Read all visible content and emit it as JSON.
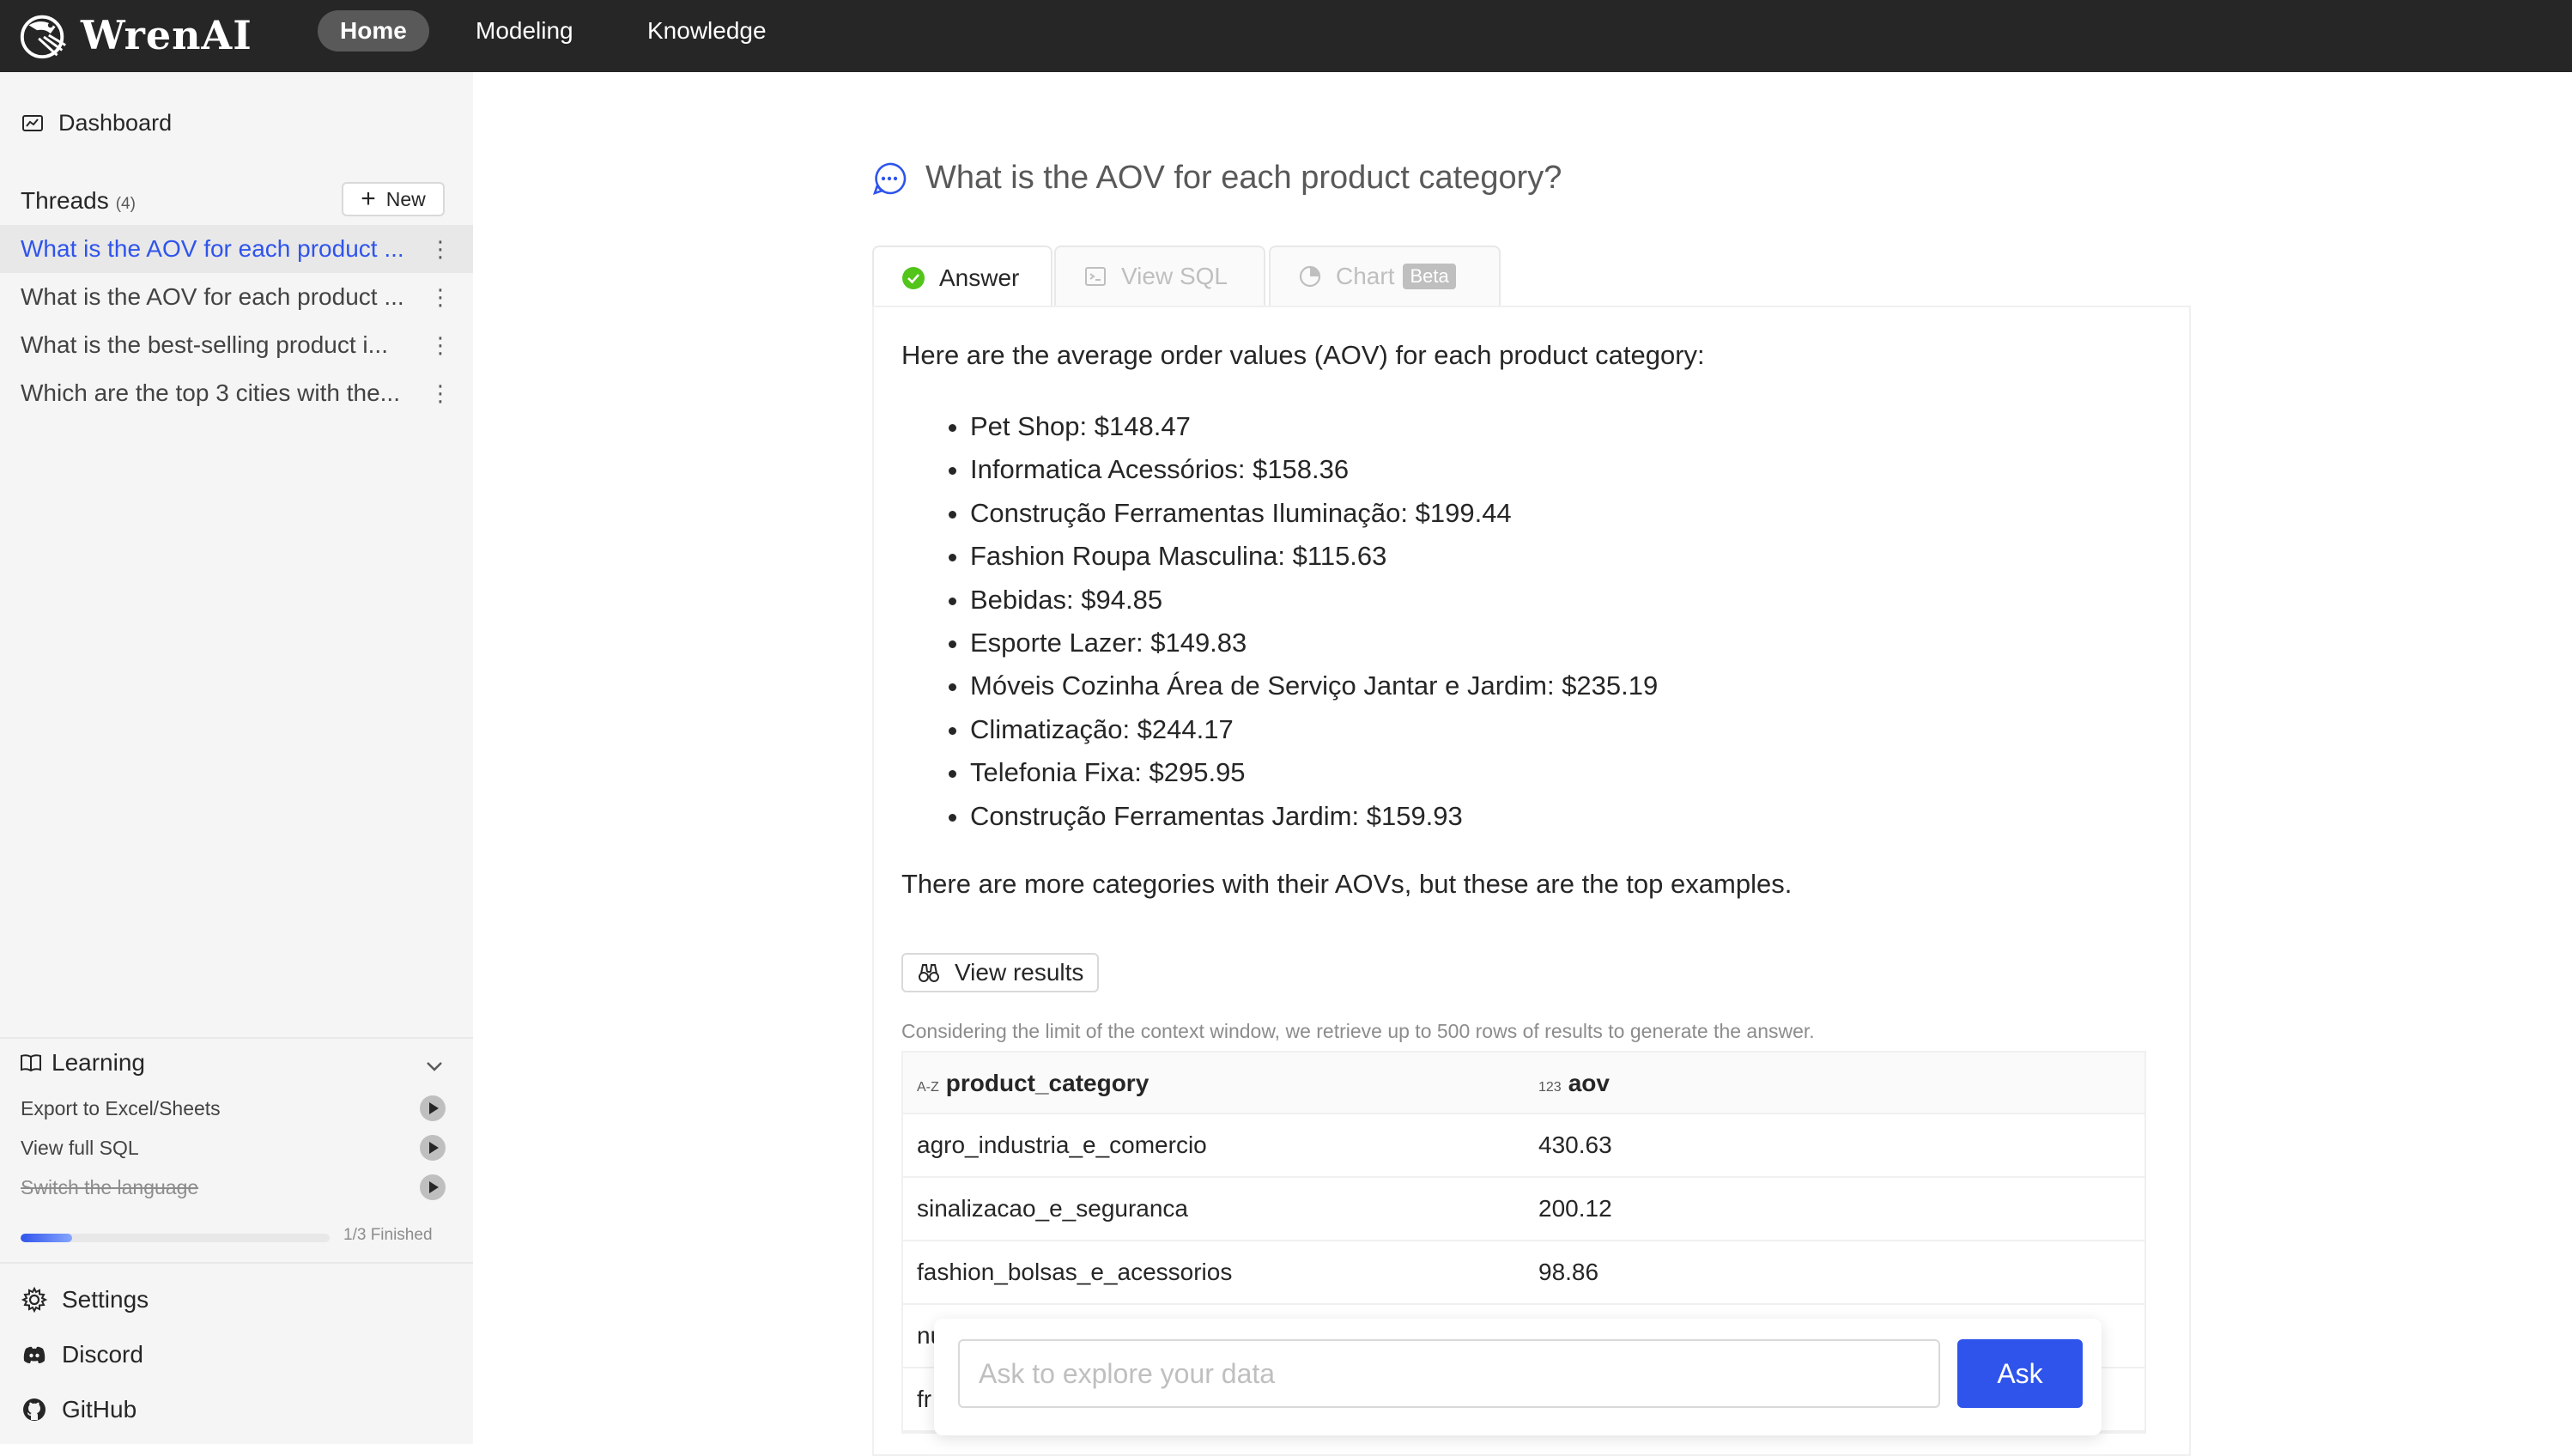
{
  "app": {
    "logo_text": "WrenAI",
    "accent_color": "#2f54eb"
  },
  "nav": {
    "items": [
      "Home",
      "Modeling",
      "Knowledge"
    ],
    "active": "Home"
  },
  "sidebar": {
    "dashboard_label": "Dashboard",
    "threads_title": "Threads",
    "threads_count": "(4)",
    "new_label": "New",
    "threads": [
      {
        "label": "What is the AOV for each product ...",
        "active": true
      },
      {
        "label": "What is the AOV for each product ...",
        "active": false
      },
      {
        "label": "What is the best-selling product i...",
        "active": false
      },
      {
        "label": "Which are the top 3 cities with the...",
        "active": false
      }
    ],
    "learning": {
      "title": "Learning",
      "items": [
        {
          "label": "Export to Excel/Sheets",
          "done": false
        },
        {
          "label": "View full SQL",
          "done": false
        },
        {
          "label": "Switch the language",
          "done": true
        }
      ],
      "progress_fraction": 0.1667,
      "progress_text": "1/3 Finished"
    },
    "settings_label": "Settings",
    "discord_label": "Discord",
    "github_label": "GitHub"
  },
  "main": {
    "question": "What is the AOV for each product category?",
    "tabs": {
      "answer": "Answer",
      "view_sql": "View SQL",
      "chart": "Chart",
      "beta": "Beta"
    },
    "answer_intro": "Here are the average order values (AOV) for each product category:",
    "bullets": [
      "Pet Shop: $148.47",
      "Informatica Acessórios: $158.36",
      "Construção Ferramentas Iluminação: $199.44",
      "Fashion Roupa Masculina: $115.63",
      "Bebidas: $94.85",
      "Esporte Lazer: $149.83",
      "Móveis Cozinha Área de Serviço Jantar e Jardim: $235.19",
      "Climatização: $244.17",
      "Telefonia Fixa: $295.95",
      "Construção Ferramentas Jardim: $159.93"
    ],
    "answer_outro": "There are more categories with their AOVs, but these are the top examples.",
    "view_results_label": "View results",
    "context_note": "Considering the limit of the context window, we retrieve up to 500 rows of results to generate the answer.",
    "table": {
      "columns": [
        {
          "type_tag": "A-Z",
          "name": "product_category"
        },
        {
          "type_tag": "123",
          "name": "aov"
        }
      ],
      "rows": [
        [
          "agro_industria_e_comercio",
          "430.63"
        ],
        [
          "sinalizacao_e_seguranca",
          "200.12"
        ],
        [
          "fashion_bolsas_e_acessorios",
          "98.86"
        ],
        [
          "nu",
          ""
        ],
        [
          "fr",
          ""
        ]
      ]
    },
    "ask": {
      "placeholder": "Ask to explore your data",
      "button_label": "Ask"
    }
  }
}
